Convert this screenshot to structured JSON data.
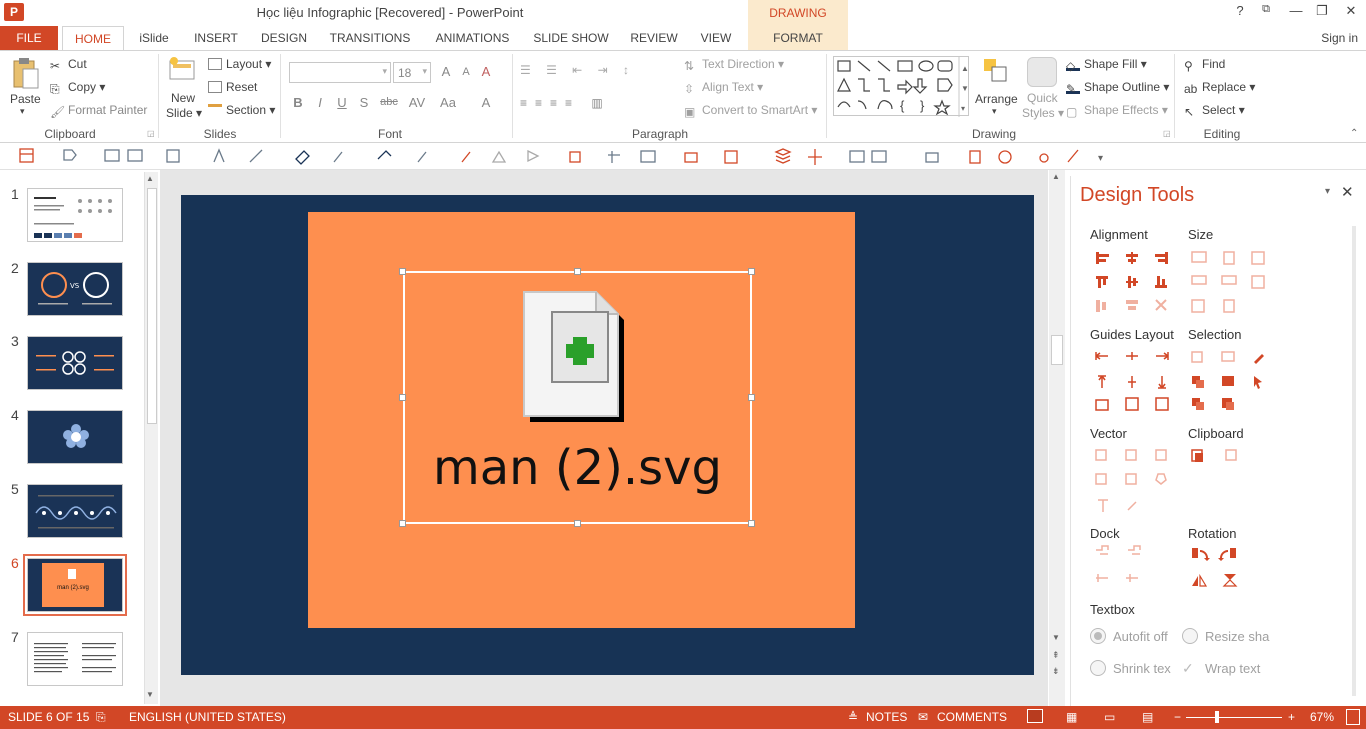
{
  "titlebar": {
    "app_icon": "P",
    "title": "Học liệu Infographic [Recovered] - PowerPoint",
    "contextual_header": "DRAWING TOOLS",
    "help": "?",
    "restore": "⧉",
    "minimize": "—",
    "maximize": "❐",
    "close": "✕"
  },
  "tabs": {
    "file": "FILE",
    "items": [
      "HOME",
      "iSlide",
      "INSERT",
      "DESIGN",
      "TRANSITIONS",
      "ANIMATIONS",
      "SLIDE SHOW",
      "REVIEW",
      "VIEW",
      "FORMAT"
    ],
    "signin": "Sign in"
  },
  "ribbon": {
    "clipboard": {
      "label": "Clipboard",
      "paste": "Paste",
      "cut": "Cut",
      "copy": "Copy",
      "format_painter": "Format Painter"
    },
    "slides": {
      "label": "Slides",
      "new_slide_line1": "New",
      "new_slide_line2": "Slide",
      "layout": "Layout",
      "reset": "Reset",
      "section": "Section"
    },
    "font": {
      "label": "Font",
      "font_size": "18",
      "bold": "B",
      "italic": "I",
      "underline": "U",
      "shadow": "S",
      "strike": "abc",
      "spacing": "AV",
      "case": "Aa",
      "color": "A",
      "grow": "A",
      "shrink": "A",
      "clear": "A"
    },
    "paragraph": {
      "label": "Paragraph",
      "text_direction": "Text Direction",
      "align_text": "Align Text",
      "convert_smartart": "Convert to SmartArt"
    },
    "drawing": {
      "label": "Drawing",
      "arrange": "Arrange",
      "quick_styles_line1": "Quick",
      "quick_styles_line2": "Styles",
      "shape_fill": "Shape Fill",
      "shape_outline": "Shape Outline",
      "shape_effects": "Shape Effects"
    },
    "editing": {
      "label": "Editing",
      "find": "Find",
      "replace": "Replace",
      "select": "Select"
    }
  },
  "slides": {
    "numbers": [
      "1",
      "2",
      "3",
      "4",
      "5",
      "6",
      "7"
    ],
    "selected_index": 6,
    "thumb6_text": "man (2).svg"
  },
  "slide": {
    "file_name": "man (2).svg"
  },
  "design_tools": {
    "title": "Design Tools",
    "sections": {
      "alignment": "Alignment",
      "size": "Size",
      "guides_layout": "Guides Layout",
      "selection": "Selection",
      "vector": "Vector",
      "clipboard": "Clipboard",
      "dock": "Dock",
      "rotation": "Rotation",
      "textbox": "Textbox"
    },
    "textbox_options": {
      "autofit": "Autofit off",
      "resize": "Resize sha",
      "shrink": "Shrink tex",
      "wrap": "Wrap text"
    }
  },
  "statusbar": {
    "slide_info": "SLIDE 6 OF 15",
    "language": "ENGLISH (UNITED STATES)",
    "notes": "NOTES",
    "comments": "COMMENTS",
    "zoom_minus": "−",
    "zoom_plus": "+",
    "zoom": "67%"
  },
  "colors": {
    "accent": "#d24726",
    "slide_background": "#173355",
    "orange_panel": "#fe8f4f",
    "contextual_tab": "#fbeacd"
  }
}
